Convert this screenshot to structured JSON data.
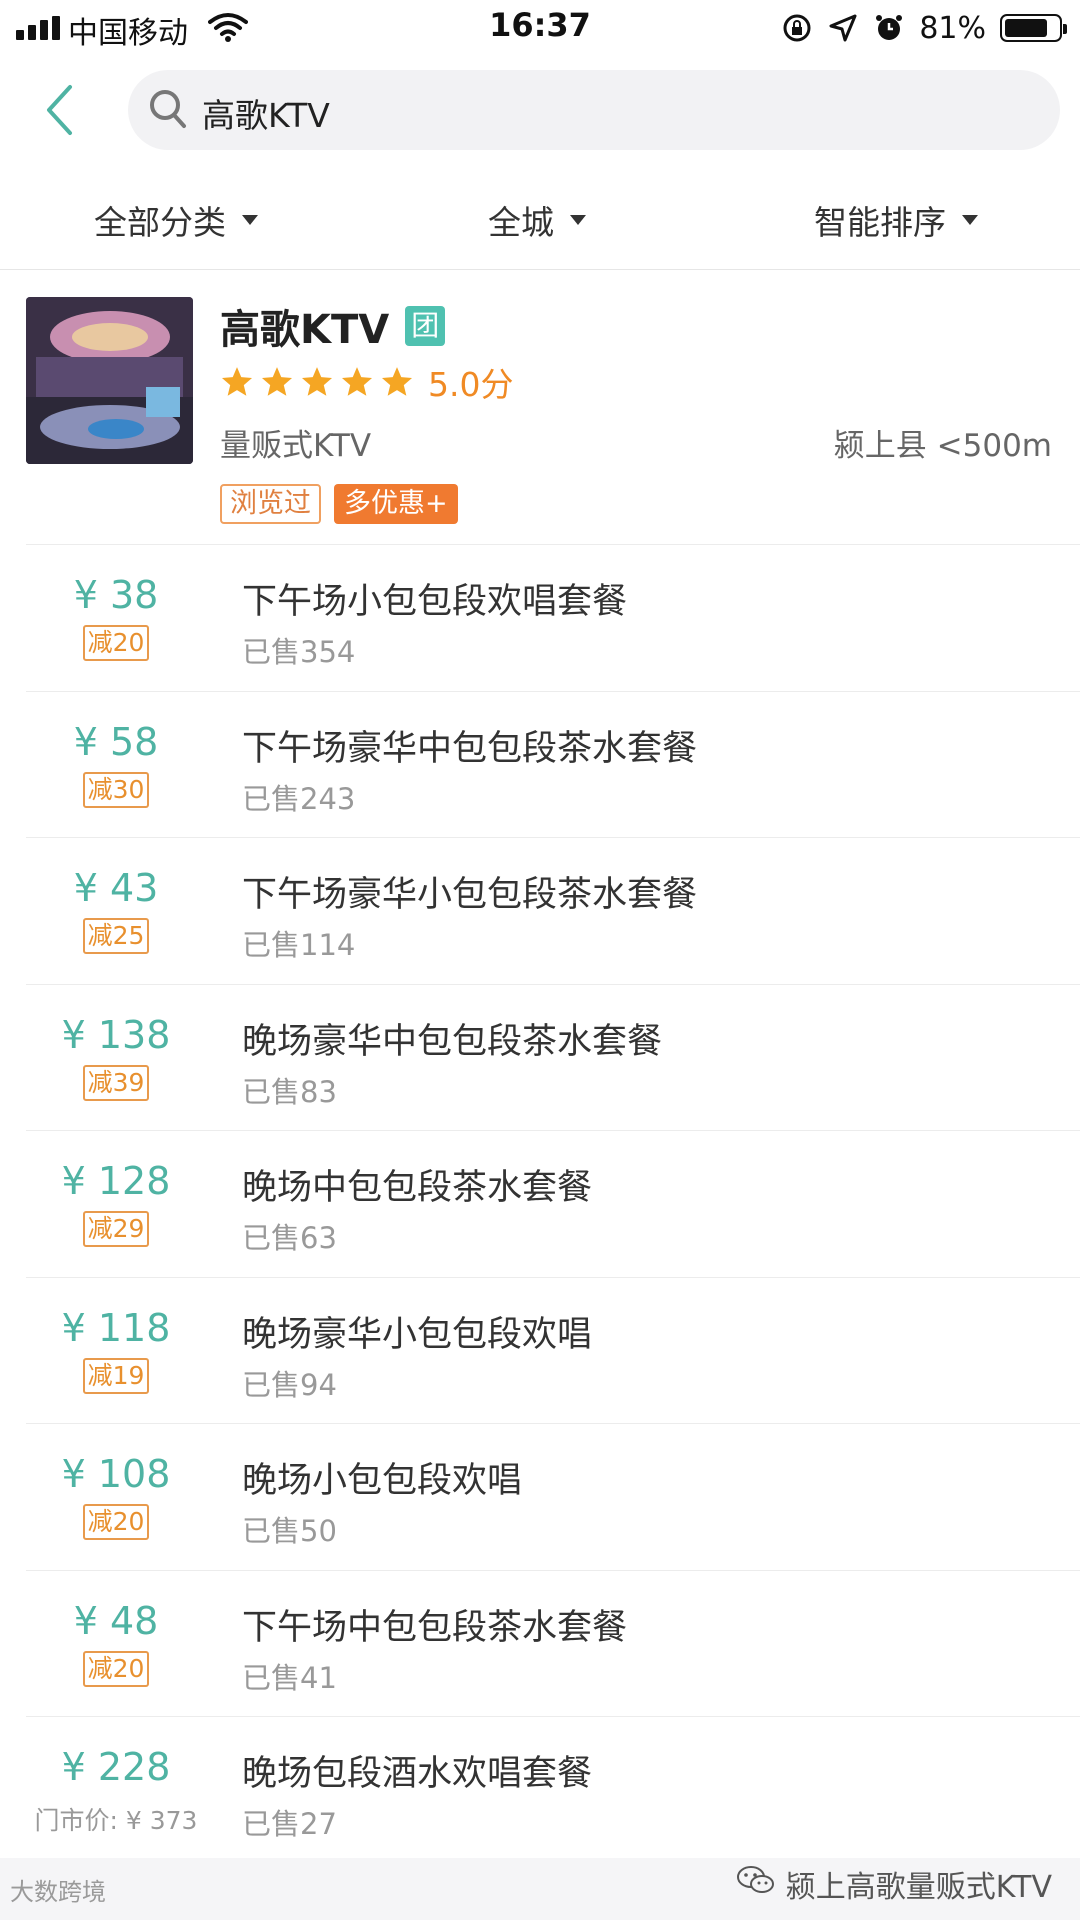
{
  "status_bar": {
    "carrier": "中国移动",
    "time": "16:37",
    "battery_percent": "81%",
    "battery_level": 0.81
  },
  "search": {
    "query": "高歌KTV"
  },
  "filters": {
    "category": "全部分类",
    "area": "全城",
    "sort": "智能排序"
  },
  "shop": {
    "name": "高歌KTV",
    "group_badge": "团",
    "rating_stars": 5,
    "score": "5.0分",
    "category": "量贩式KTV",
    "location": "颍上县 <500m",
    "tag_viewed": "浏览过",
    "tag_offers": "多优惠+"
  },
  "deals": [
    {
      "price": "¥ 38",
      "discount": "减20",
      "title": "下午场小包包段欢唱套餐",
      "sold": "已售354"
    },
    {
      "price": "¥ 58",
      "discount": "减30",
      "title": "下午场豪华中包包段茶水套餐",
      "sold": "已售243"
    },
    {
      "price": "¥ 43",
      "discount": "减25",
      "title": "下午场豪华小包包段茶水套餐",
      "sold": "已售114"
    },
    {
      "price": "¥ 138",
      "discount": "减39",
      "title": "晚场豪华中包包段茶水套餐",
      "sold": "已售83"
    },
    {
      "price": "¥ 128",
      "discount": "减29",
      "title": "晚场中包包段茶水套餐",
      "sold": "已售63"
    },
    {
      "price": "¥ 118",
      "discount": "减19",
      "title": "晚场豪华小包包段欢唱",
      "sold": "已售94"
    },
    {
      "price": "¥ 108",
      "discount": "减20",
      "title": "晚场小包包段欢唱",
      "sold": "已售50"
    },
    {
      "price": "¥ 48",
      "discount": "减20",
      "title": "下午场中包包段茶水套餐",
      "sold": "已售41"
    },
    {
      "price": "¥ 228",
      "original_price": "门市价: ¥ 373",
      "title": "晚场包段酒水欢唱套餐",
      "sold": "已售27"
    }
  ],
  "watermark": {
    "left": "大数跨境",
    "right": "颍上高歌量贩式KTV"
  },
  "colors": {
    "accent": "#4fb3a3",
    "orange": "#f08a24",
    "badge": "#e8902e"
  }
}
